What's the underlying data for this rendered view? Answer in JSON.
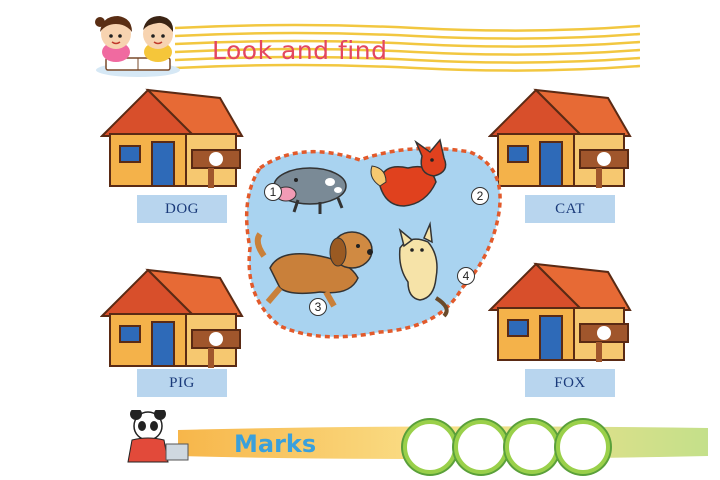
{
  "header": {
    "title": "Look and find"
  },
  "houses": [
    {
      "label": "DOG"
    },
    {
      "label": "CAT"
    },
    {
      "label": "PIG"
    },
    {
      "label": "FOX"
    }
  ],
  "animals": [
    {
      "number": "1"
    },
    {
      "number": "2"
    },
    {
      "number": "3"
    },
    {
      "number": "4"
    }
  ],
  "footer": {
    "marks_label": "Marks"
  },
  "colors": {
    "title": "#e4475f",
    "band": "#f2c740",
    "pond": "#a9d3f0",
    "pond_border": "#e25a2b",
    "label_bg": "#b8d5ee",
    "marks_text": "#3aa0dc"
  }
}
